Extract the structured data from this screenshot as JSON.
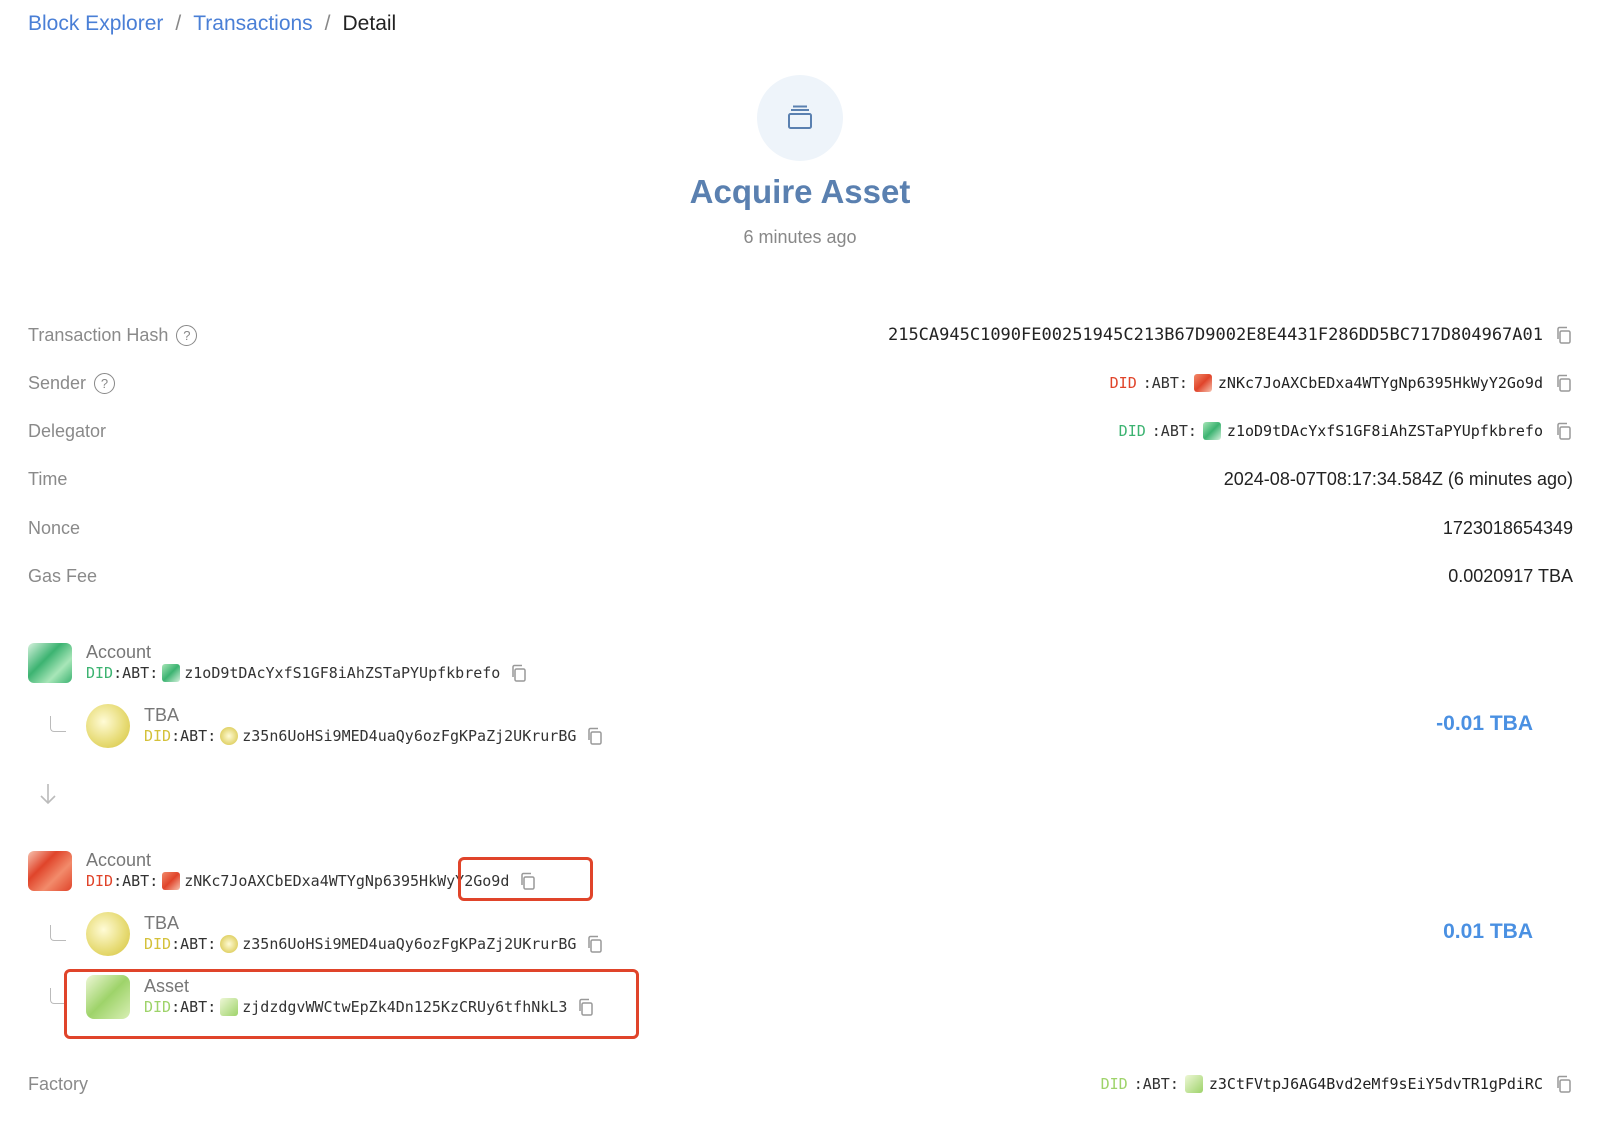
{
  "breadcrumb": {
    "block_explorer": "Block Explorer",
    "sep1": "/",
    "transactions": "Transactions",
    "sep2": "/",
    "detail": "Detail"
  },
  "header": {
    "title": "Acquire Asset",
    "subtitle": "6 minutes ago",
    "icon": "stack-icon"
  },
  "info": {
    "tx_hash_label": "Transaction Hash",
    "tx_hash": "215CA945C1090FE00251945C213B67D9002E8E4431F286DD5BC717D804967A01",
    "sender_label": "Sender",
    "sender_did_prefix": "DID",
    "sender_did_abt": ":ABT:",
    "sender_address": "zNKc7JoAXCbEDxa4WTYgNp6395HkWyY2Go9d",
    "delegator_label": "Delegator",
    "delegator_did_prefix": "DID",
    "delegator_did_abt": ":ABT:",
    "delegator_address": "z1oD9tDAcYxfS1GF8iAhZSTaPYUpfkbrefo",
    "time_label": "Time",
    "time_value": "2024-08-07T08:17:34.584Z (6 minutes ago)",
    "nonce_label": "Nonce",
    "nonce_value": "1723018654349",
    "gas_label": "Gas Fee",
    "gas_value": "0.0020917 TBA",
    "factory_label": "Factory",
    "factory_did_prefix": "DID",
    "factory_did_abt": ":ABT:",
    "factory_address": "z3CtFVtpJ6AG4Bvd2eMf9sEiY5dvTR1gPdiRC"
  },
  "flow": {
    "from_account": {
      "type": "Account",
      "did_prefix": "DID",
      "did_abt": ":ABT:",
      "address": "z1oD9tDAcYxfS1GF8iAhZSTaPYUpfkbrefo"
    },
    "from_token": {
      "type": "TBA",
      "did_prefix": "DID",
      "did_abt": ":ABT:",
      "address": "z35n6UoHSi9MED4uaQy6ozFgKPaZj2UKrurBG",
      "amount": "-0.01 TBA"
    },
    "to_account": {
      "type": "Account",
      "did_prefix": "DID",
      "did_abt": ":ABT:",
      "address": "zNKc7JoAXCbEDxa4WTYgNp6395HkWyY2Go9d"
    },
    "to_token": {
      "type": "TBA",
      "did_prefix": "DID",
      "did_abt": ":ABT:",
      "address": "z35n6UoHSi9MED4uaQy6ozFgKPaZj2UKrurBG",
      "amount": "0.01 TBA"
    },
    "to_asset": {
      "type": "Asset",
      "did_prefix": "DID",
      "did_abt": ":ABT:",
      "address": "zjdzdgvWWCtwEpZk4Dn125KzCRUy6tfhNkL3"
    }
  },
  "colors": {
    "link": "#4a7fd6",
    "title": "#5a80b0",
    "amount": "#4a90e2",
    "did_red": "#e0442a",
    "did_green": "#3cb371",
    "did_yellow": "#d4c13a",
    "did_lightgreen": "#9ed36a",
    "highlight": "#e0442a"
  }
}
